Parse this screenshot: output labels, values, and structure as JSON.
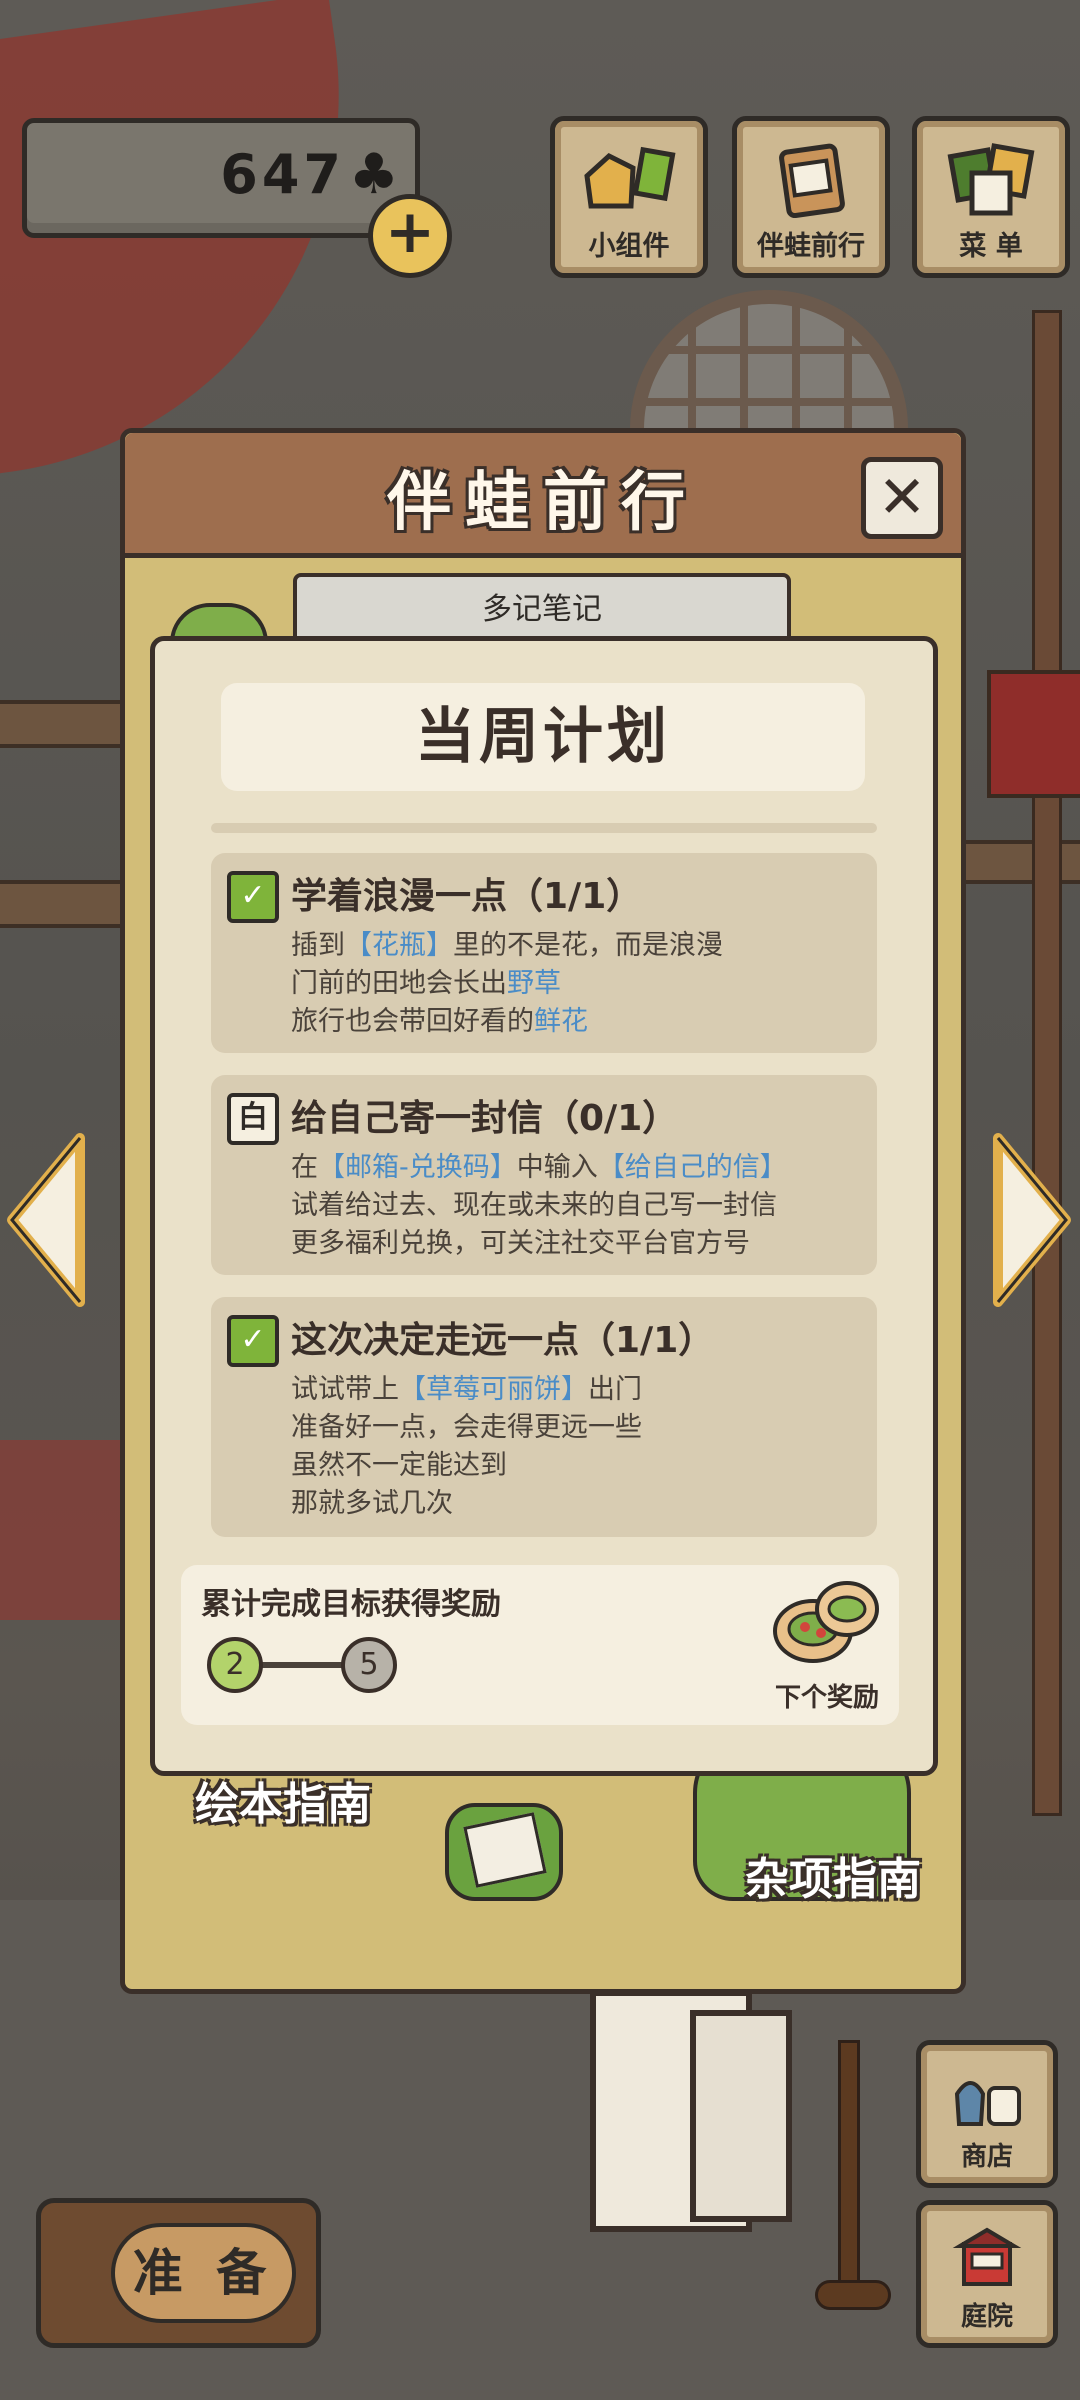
{
  "hud": {
    "clover_count": "647",
    "plus_label": "+",
    "buttons": {
      "widgets": "小组件",
      "travel_with_frog": "伴蛙前行",
      "menu": "菜 单"
    },
    "side": {
      "shop": "商店",
      "yard": "庭院"
    },
    "prepare": "准 备"
  },
  "dialog": {
    "title": "伴蛙前行",
    "close": "✕",
    "note_tab": "多记笔记",
    "guide_left": "绘本指南",
    "guide_right": "杂项指南"
  },
  "plan": {
    "title": "当周计划",
    "tasks": [
      {
        "status": "done",
        "title": "学着浪漫一点（1/1）",
        "lines": [
          {
            "pre": "插到",
            "hl": "【花瓶】",
            "post": "里的不是花，而是浪漫"
          },
          {
            "pre": "门前的田地会长出",
            "hl": "野草",
            "post": ""
          },
          {
            "pre": "旅行也会带回好看的",
            "hl": "鲜花",
            "post": ""
          }
        ]
      },
      {
        "status": "todo",
        "title": "给自己寄一封信（0/1）",
        "lines": [
          {
            "pre": "在",
            "hl": "【邮箱-兑换码】",
            "post": "中输入",
            "hl2": "【给自己的信】"
          },
          {
            "pre": "试着给过去、现在或未来的自己写一封信",
            "hl": "",
            "post": ""
          },
          {
            "pre": "更多福利兑换，可关注社交平台官方号",
            "hl": "",
            "post": ""
          }
        ]
      },
      {
        "status": "done",
        "title": "这次决定走远一点（1/1）",
        "lines": [
          {
            "pre": "试试带上",
            "hl": "【草莓可丽饼】",
            "post": "出门"
          },
          {
            "pre": "准备好一点，会走得更远一些",
            "hl": "",
            "post": ""
          },
          {
            "pre": "虽然不一定能达到",
            "hl": "",
            "post": ""
          },
          {
            "pre": "那就多试几次",
            "hl": "",
            "post": ""
          }
        ]
      }
    ],
    "reward": {
      "label": "累计完成目标获得奖励",
      "current": "2",
      "goal": "5",
      "next_label": "下个奖励"
    }
  },
  "colors": {
    "highlight": "#4a8cc7",
    "done_green": "#7fb43a",
    "dialog_header": "#9e6e4e"
  },
  "icons": [
    "clover-icon",
    "plus-icon",
    "widget-icon",
    "journal-icon",
    "menu-icon",
    "close-icon",
    "check-calendar-icon",
    "calendar-icon",
    "arrow-left-icon",
    "arrow-right-icon",
    "shop-icon",
    "yard-icon",
    "dumpling-icon"
  ]
}
